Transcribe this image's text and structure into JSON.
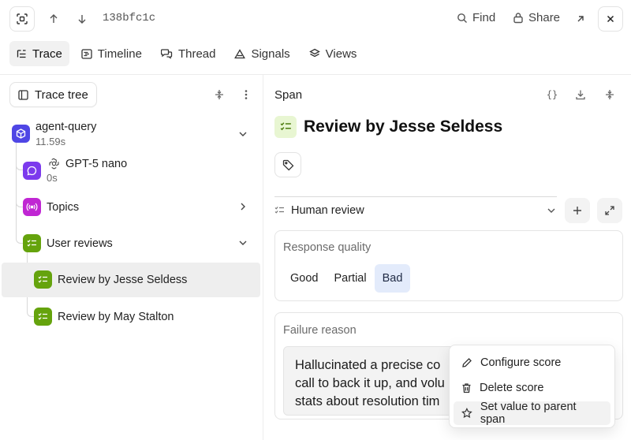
{
  "topbar": {
    "trace_id": "138bfc1c",
    "find_label": "Find",
    "share_label": "Share"
  },
  "tabs": [
    {
      "label": "Trace",
      "active": true
    },
    {
      "label": "Timeline"
    },
    {
      "label": "Thread"
    },
    {
      "label": "Signals"
    },
    {
      "label": "Views"
    }
  ],
  "left": {
    "trace_tree_label": "Trace tree",
    "nodes": [
      {
        "title": "agent-query",
        "sub": "11.59s",
        "icon": "cube-icon",
        "color": "#4f46e5"
      },
      {
        "title": "GPT-5 nano",
        "sub": "0s",
        "icon": "chat-bubble-icon",
        "color": "#7c3aed",
        "model_icon": "openai-logo-icon"
      },
      {
        "title": "Topics",
        "icon": "radio-signal-icon",
        "color": "#c026d3"
      },
      {
        "title": "User reviews",
        "icon": "checklist-icon",
        "color": "#65a30d"
      },
      {
        "title": "Review by Jesse Seldess",
        "icon": "checklist-icon",
        "color": "#65a30d",
        "selected": true
      },
      {
        "title": "Review by May Stalton",
        "icon": "checklist-icon",
        "color": "#65a30d"
      }
    ]
  },
  "right": {
    "header_label": "Span",
    "title": "Review by Jesse Seldess",
    "review_type": "Human review",
    "response_quality": {
      "label": "Response quality",
      "options": [
        "Good",
        "Partial",
        "Bad"
      ],
      "selected": "Bad"
    },
    "failure_reason": {
      "label": "Failure reason",
      "lines": [
        "Hallucinated a precise co",
        "call to back it up, and volu",
        "stats about resolution tim"
      ]
    }
  },
  "context_menu": {
    "items": [
      {
        "label": "Configure score",
        "icon": "pencil-icon"
      },
      {
        "label": "Delete score",
        "icon": "trash-icon"
      },
      {
        "label": "Set value to parent span",
        "icon": "star-icon",
        "highlighted": true
      }
    ]
  },
  "colors": {
    "checklist_bg": "#e8f6d2",
    "checklist_fg": "#4d7c0f",
    "selected_option_bg": "#e3ebfb",
    "selected_row_bg": "#eeeeee"
  }
}
